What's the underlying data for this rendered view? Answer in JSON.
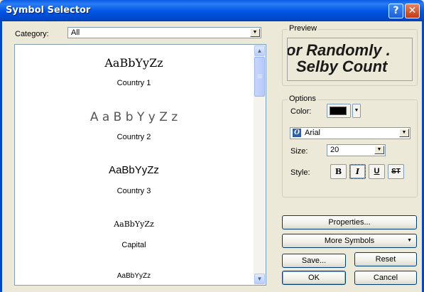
{
  "window": {
    "title": "Symbol Selector",
    "help_glyph": "?",
    "close_glyph": "✕"
  },
  "category": {
    "label": "Category:",
    "value": "All"
  },
  "symbols": [
    {
      "sample": "AaBbYyZz",
      "name": "Country 1"
    },
    {
      "sample": "A a B b Y y Z z",
      "name": "Country 2"
    },
    {
      "sample": "AaBbYyZz",
      "name": "Country 3"
    },
    {
      "sample": "AaBbYyZz",
      "name": "Capital"
    },
    {
      "sample": "AaBbYyZz",
      "name": ""
    }
  ],
  "preview": {
    "label": "Preview",
    "line1": "or Randomly .",
    "line2": "Selby Count"
  },
  "options": {
    "label": "Options",
    "color_label": "Color:",
    "color_value": "#000000",
    "font_value": "Arial",
    "font_icon_glyph": "O",
    "size_label": "Size:",
    "size_value": "20",
    "style_label": "Style:",
    "style_bold": "B",
    "style_italic": "I",
    "style_underline": "U",
    "style_strike": "ST"
  },
  "buttons": {
    "properties": "Properties...",
    "more_symbols": "More Symbols",
    "save": "Save...",
    "reset": "Reset",
    "ok": "OK",
    "cancel": "Cancel"
  }
}
